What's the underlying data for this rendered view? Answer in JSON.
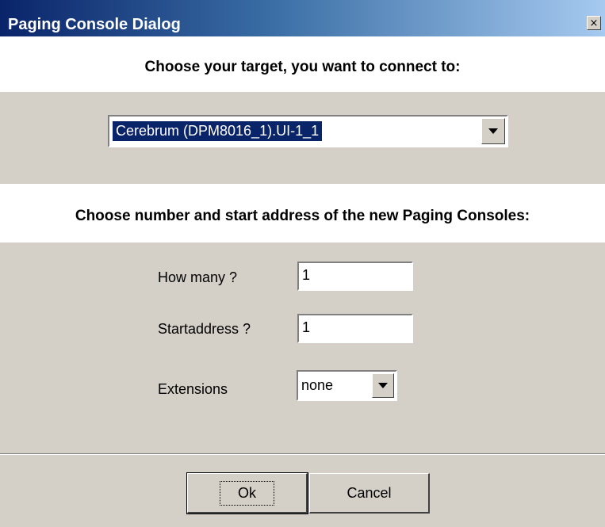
{
  "window": {
    "title": "Paging Console Dialog",
    "close_glyph": "×"
  },
  "target_section": {
    "heading": "Choose your target, you want to connect to:",
    "selected_target": "Cerebrum (DPM8016_1).UI-1_1"
  },
  "consoles_section": {
    "heading": "Choose number and start address of the new Paging Consoles:",
    "how_many": {
      "label": "How many ?",
      "value": "1"
    },
    "start_address": {
      "label": "Startaddress ?",
      "value": "1"
    },
    "extensions": {
      "label": "Extensions",
      "value": "none"
    }
  },
  "buttons": {
    "ok": "Ok",
    "cancel": "Cancel"
  },
  "icons": {
    "close": "close-icon",
    "dropdown": "chevron-down-icon"
  },
  "colors": {
    "titlebar_start": "#0a246a",
    "titlebar_end": "#a6caf0",
    "panel": "#d4d0c8",
    "selection": "#0a246a"
  }
}
